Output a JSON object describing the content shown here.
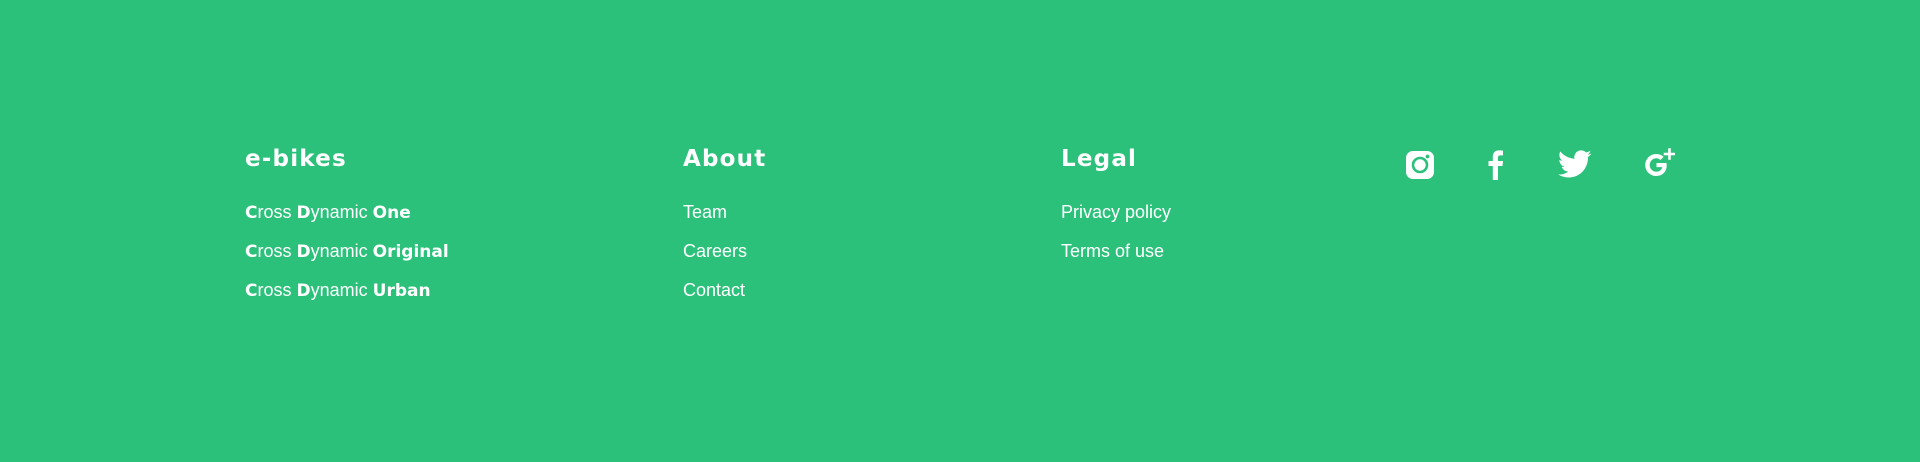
{
  "footer": {
    "columns": [
      {
        "title": "e-bikes",
        "items": [
          {
            "c": "C",
            "ross": "ross ",
            "d": "D",
            "ynamic": "ynamic ",
            "model": "One"
          },
          {
            "c": "C",
            "ross": "ross ",
            "d": "D",
            "ynamic": "ynamic ",
            "model": "Original"
          },
          {
            "c": "C",
            "ross": "ross ",
            "d": "D",
            "ynamic": "ynamic ",
            "model": "Urban"
          }
        ]
      },
      {
        "title": "About",
        "items": [
          {
            "label": "Team"
          },
          {
            "label": "Careers"
          },
          {
            "label": "Contact"
          }
        ]
      },
      {
        "title": "Legal",
        "items": [
          {
            "label": "Privacy policy"
          },
          {
            "label": "Terms of use"
          }
        ]
      }
    ],
    "social": [
      "instagram-icon",
      "facebook-icon",
      "twitter-icon",
      "google-plus-icon"
    ]
  },
  "colors": {
    "background": "#2cc17b",
    "text": "#ffffff"
  }
}
